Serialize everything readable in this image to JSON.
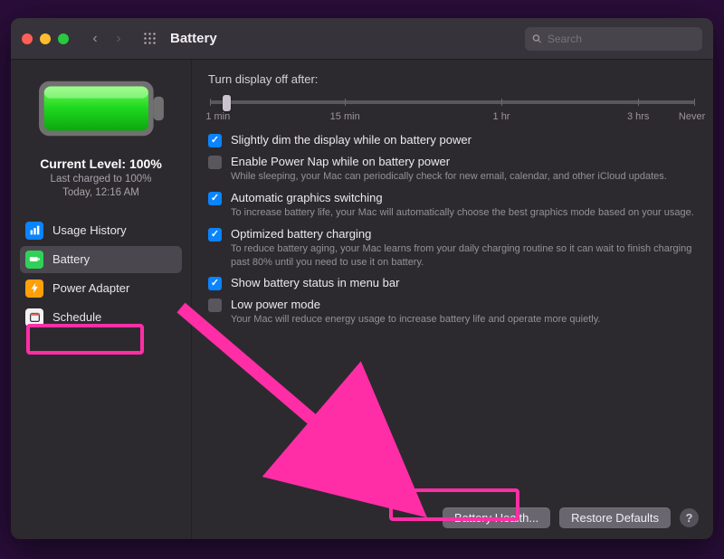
{
  "header": {
    "title": "Battery",
    "search_placeholder": "Search"
  },
  "sidebar": {
    "current_level": "Current Level: 100%",
    "last_charged": "Last charged to 100%",
    "timestamp": "Today, 12:16 AM",
    "items": [
      {
        "label": "Usage History"
      },
      {
        "label": "Battery"
      },
      {
        "label": "Power Adapter"
      },
      {
        "label": "Schedule"
      }
    ]
  },
  "main": {
    "slider_title": "Turn display off after:",
    "slider_labels": [
      "1 min",
      "15 min",
      "1 hr",
      "3 hrs",
      "Never"
    ],
    "options": [
      {
        "label": "Slightly dim the display while on battery power",
        "checked": true,
        "desc": ""
      },
      {
        "label": "Enable Power Nap while on battery power",
        "checked": false,
        "desc": "While sleeping, your Mac can periodically check for new email, calendar, and other iCloud updates."
      },
      {
        "label": "Automatic graphics switching",
        "checked": true,
        "desc": "To increase battery life, your Mac will automatically choose the best graphics mode based on your usage."
      },
      {
        "label": "Optimized battery charging",
        "checked": true,
        "desc": "To reduce battery aging, your Mac learns from your daily charging routine so it can wait to finish charging past 80% until you need to use it on battery."
      },
      {
        "label": "Show battery status in menu bar",
        "checked": true,
        "desc": ""
      },
      {
        "label": "Low power mode",
        "checked": false,
        "desc": "Your Mac will reduce energy usage to increase battery life and operate more quietly."
      }
    ],
    "buttons": {
      "health": "Battery Health...",
      "restore": "Restore Defaults",
      "help": "?"
    }
  }
}
